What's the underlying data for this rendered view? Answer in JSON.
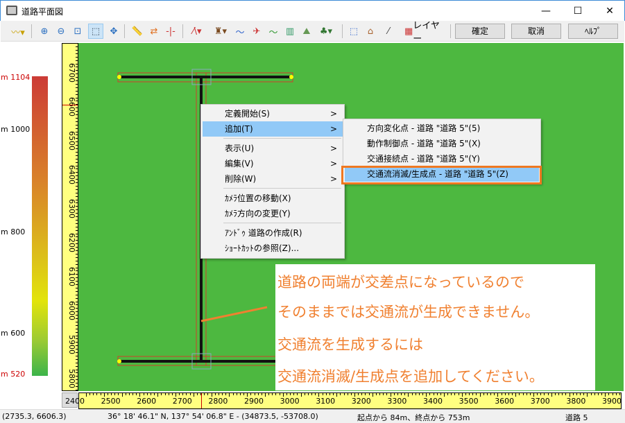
{
  "window": {
    "title": "道路平面図",
    "minimize": "—",
    "maximize": "☐",
    "close": "✕"
  },
  "toolbar": {
    "layer_label": "レイヤー",
    "ok": "確定",
    "cancel": "取消",
    "help": "ﾍﾙﾌﾟ"
  },
  "legend": {
    "labels": [
      "1104 m",
      "1000 m",
      "800 m",
      "600 m",
      "520 m"
    ],
    "colors": {
      "top": "#cc3b36",
      "bottom": "#3cb44a"
    }
  },
  "vruler": {
    "labels": [
      "6700",
      "6600",
      "6500",
      "6400",
      "6300",
      "6200",
      "6100",
      "6000",
      "5900",
      "5800"
    ]
  },
  "hruler": {
    "labels": [
      "2400",
      "2500",
      "2600",
      "2700",
      "2800",
      "2900",
      "3000",
      "3100",
      "3200",
      "3300",
      "3400",
      "3500",
      "3600",
      "3700",
      "3800",
      "3900"
    ]
  },
  "context_menu": {
    "items": [
      {
        "label": "定義開始(S)",
        "submenu": true
      },
      {
        "label": "追加(T)",
        "submenu": true,
        "highlighted": true
      },
      {
        "label": "表示(U)",
        "submenu": true
      },
      {
        "label": "編集(V)",
        "submenu": true
      },
      {
        "label": "削除(W)",
        "submenu": true
      },
      {
        "label": "ｶﾒﾗ位置の移動(X)"
      },
      {
        "label": "ｶﾒﾗ方向の変更(Y)"
      },
      {
        "label": "ｱﾝﾄﾞｩ 道路の作成(R)"
      },
      {
        "label": "ｼｮｰﾄｶｯﾄの参照(Z)..."
      }
    ],
    "arrow": ">"
  },
  "submenu": {
    "items": [
      "方向変化点 - 道路 \"道路 5\"(5)",
      "動作制御点 - 道路 \"道路 5\"(X)",
      "交通接続点 - 道路 \"道路 5\"(Y)",
      "交通流消滅/生成点 - 道路 \"道路 5\"(Z)"
    ]
  },
  "annotation": {
    "lines": [
      "道路の両端が交差点になっているので",
      "そのままでは交通流が生成できません。",
      "交通流を生成するには",
      "交通流消滅/生成点を追加してください。"
    ],
    "color": "#f08030"
  },
  "status": {
    "coords": "(2735.3, 6606.3)",
    "geo": "36° 18' 46.1\" N, 137° 54' 06.8\" E  -  (34873.5, -53708.0)",
    "distance": "起点から 84m、終点から 753m",
    "road": "道路 5"
  }
}
